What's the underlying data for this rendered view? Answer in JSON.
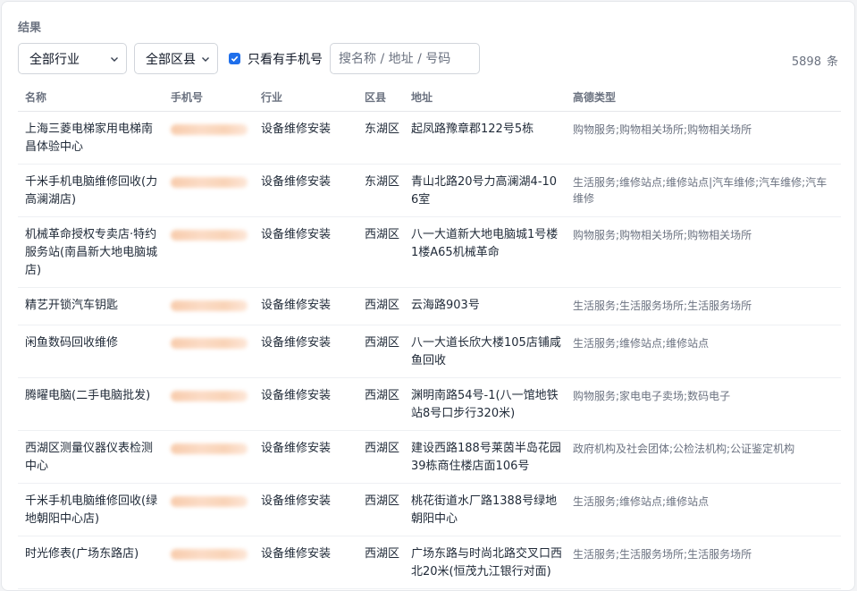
{
  "section": {
    "title": "结果"
  },
  "filters": {
    "industry_selected": "全部行业",
    "district_selected": "全部区县",
    "only_phone_label": "只看有手机号",
    "only_phone_checked": true,
    "search_placeholder": "搜名称 / 地址 / 号码"
  },
  "results": {
    "count": "5898",
    "count_unit": "条"
  },
  "colors": {
    "accent": "#1f6feb",
    "muted_text": "#6b7280",
    "border": "#e5e7eb"
  },
  "icons": {
    "select_arrow": "chevron-down-icon",
    "checkbox": "check-icon"
  },
  "table": {
    "columns": [
      "名称",
      "手机号",
      "行业",
      "区县",
      "地址",
      "高德类型"
    ],
    "rows": [
      {
        "name": "上海三菱电梯家用电梯南昌体验中心",
        "industry": "设备维修安装",
        "district": "东湖区",
        "address": "起凤路豫章郡122号5栋",
        "amap_type": "购物服务;购物相关场所;购物相关场所"
      },
      {
        "name": "千米手机电脑维修回收(力高澜湖店)",
        "industry": "设备维修安装",
        "district": "东湖区",
        "address": "青山北路20号力高澜湖4-106室",
        "amap_type": "生活服务;维修站点;维修站点|汽车维修;汽车维修;汽车维修"
      },
      {
        "name": "机械革命授权专卖店·特约服务站(南昌新大地电脑城店)",
        "industry": "设备维修安装",
        "district": "西湖区",
        "address": "八一大道新大地电脑城1号楼1楼A65机械革命",
        "amap_type": "购物服务;购物相关场所;购物相关场所"
      },
      {
        "name": "精艺开锁汽车钥匙",
        "industry": "设备维修安装",
        "district": "西湖区",
        "address": "云海路903号",
        "amap_type": "生活服务;生活服务场所;生活服务场所"
      },
      {
        "name": "闲鱼数码回收维修",
        "industry": "设备维修安装",
        "district": "西湖区",
        "address": "八一大道长欣大楼105店铺咸鱼回收",
        "amap_type": "生活服务;维修站点;维修站点"
      },
      {
        "name": "腾曜电脑(二手电脑批发)",
        "industry": "设备维修安装",
        "district": "西湖区",
        "address": "渊明南路54号-1(八一馆地铁站8号口步行320米)",
        "amap_type": "购物服务;家电电子卖场;数码电子"
      },
      {
        "name": "西湖区测量仪器仪表检测中心",
        "industry": "设备维修安装",
        "district": "西湖区",
        "address": "建设西路188号莱茵半岛花园39栋商住楼店面106号",
        "amap_type": "政府机构及社会团体;公检法机构;公证鉴定机构"
      },
      {
        "name": "千米手机电脑维修回收(绿地朝阳中心店)",
        "industry": "设备维修安装",
        "district": "西湖区",
        "address": "桃花街道水厂路1388号绿地朝阳中心",
        "amap_type": "生活服务;维修站点;维修站点"
      },
      {
        "name": "时光修表(广场东路店)",
        "industry": "设备维修安装",
        "district": "西湖区",
        "address": "广场东路与时尚北路交叉口西北20米(恒茂九江银行对面)",
        "amap_type": "生活服务;生活服务场所;生活服务场所"
      }
    ]
  }
}
